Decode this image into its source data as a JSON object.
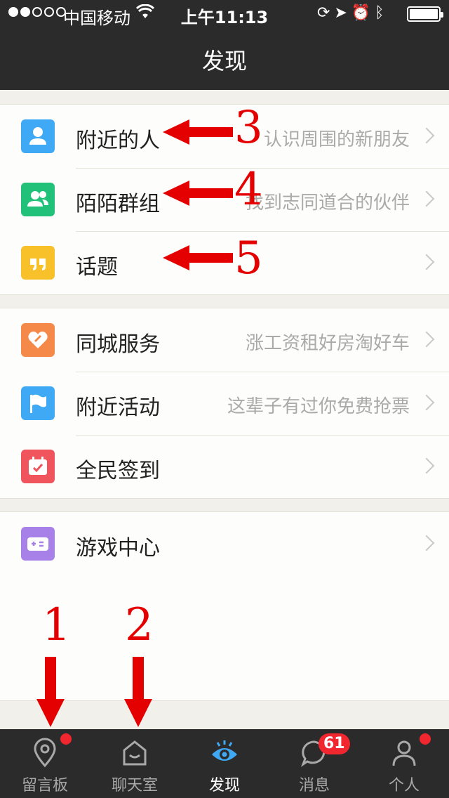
{
  "status_bar": {
    "carrier": "中国移动",
    "time": "上午11:13"
  },
  "header": {
    "title": "发现"
  },
  "groups": [
    {
      "items": [
        {
          "label": "附近的人",
          "subtitle": "认识周围的新朋友",
          "icon": "person-icon",
          "color": "#3fa9f5"
        },
        {
          "label": "陌陌群组",
          "subtitle": "找到志同道合的伙伴",
          "icon": "group-icon",
          "color": "#22c17a"
        },
        {
          "label": "话题",
          "subtitle": "",
          "icon": "quote-icon",
          "color": "#f8c12a"
        }
      ]
    },
    {
      "items": [
        {
          "label": "同城服务",
          "subtitle": "涨工资租好房淘好车",
          "icon": "heart-tag-icon",
          "color": "#f5894a"
        },
        {
          "label": "附近活动",
          "subtitle": "这辈子有过你免费抢票",
          "icon": "flag-icon",
          "color": "#3fa9f5"
        },
        {
          "label": "全民签到",
          "subtitle": "",
          "icon": "calendar-check-icon",
          "color": "#f0545c"
        }
      ]
    },
    {
      "items": [
        {
          "label": "游戏中心",
          "subtitle": "",
          "icon": "gamepad-icon",
          "color": "#a781e8"
        }
      ]
    }
  ],
  "annotations": {
    "labels": [
      "1",
      "2",
      "3",
      "4",
      "5"
    ],
    "color": "#e40000"
  },
  "tabbar": {
    "tabs": [
      {
        "label": "留言板",
        "icon": "location-pin-icon",
        "dot": true
      },
      {
        "label": "聊天室",
        "icon": "chat-room-icon",
        "dot": false
      },
      {
        "label": "发现",
        "icon": "eye-icon",
        "active": true
      },
      {
        "label": "消息",
        "icon": "message-bubble-icon",
        "badge": "61"
      },
      {
        "label": "个人",
        "icon": "profile-icon",
        "dot": true
      }
    ],
    "active_color": "#3fa9f5"
  }
}
